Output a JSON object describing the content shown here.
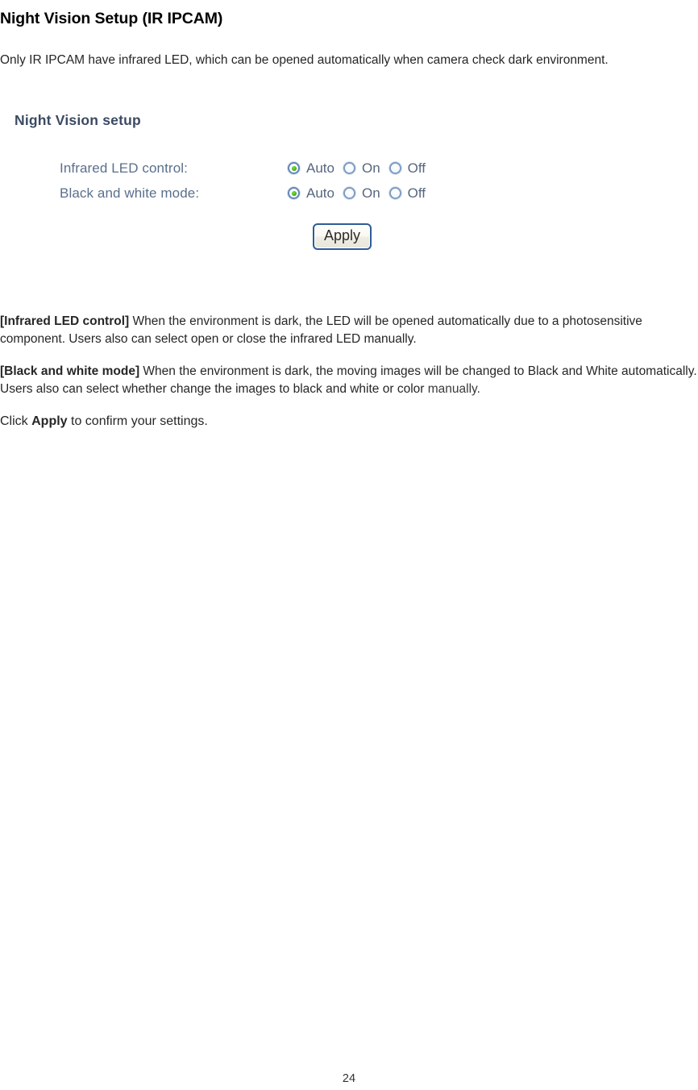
{
  "document": {
    "title": "Night Vision Setup (IR IPCAM)",
    "intro": "Only IR IPCAM have infrared LED, which can be opened automatically when camera check dark environment.",
    "page_number": "24"
  },
  "ui_panel": {
    "heading": "Night Vision setup",
    "rows": [
      {
        "label": "Infrared LED control:",
        "options": [
          {
            "label": "Auto",
            "selected": true
          },
          {
            "label": "On",
            "selected": false
          },
          {
            "label": "Off",
            "selected": false
          }
        ]
      },
      {
        "label": "Black and white mode:",
        "options": [
          {
            "label": "Auto",
            "selected": true
          },
          {
            "label": "On",
            "selected": false
          },
          {
            "label": "Off",
            "selected": false
          }
        ]
      }
    ],
    "apply_label": "Apply",
    "colors": {
      "heading_text": "#3b4a63",
      "row_label_text": "#5a6f8c",
      "radio_ring": "#7b9cc4",
      "radio_dot": "#3aa80f",
      "button_border": "#2e5c96"
    }
  },
  "descriptions": {
    "para1_term": "[Infrared LED control]",
    "para1_text": " When the environment is dark, the LED will be opened automatically due to a photosensitive component. Users also can select open or close the infrared LED manually.",
    "para2_term": "[Black and white mode]",
    "para2_text": " When the environment is dark, the moving images will be changed to Black and White automatically. Users also can select whether change the images to black and white or color ",
    "para2_tail": "manually.",
    "para3_pre": "Click ",
    "para3_term": "Apply",
    "para3_post": " to confirm your settings."
  }
}
